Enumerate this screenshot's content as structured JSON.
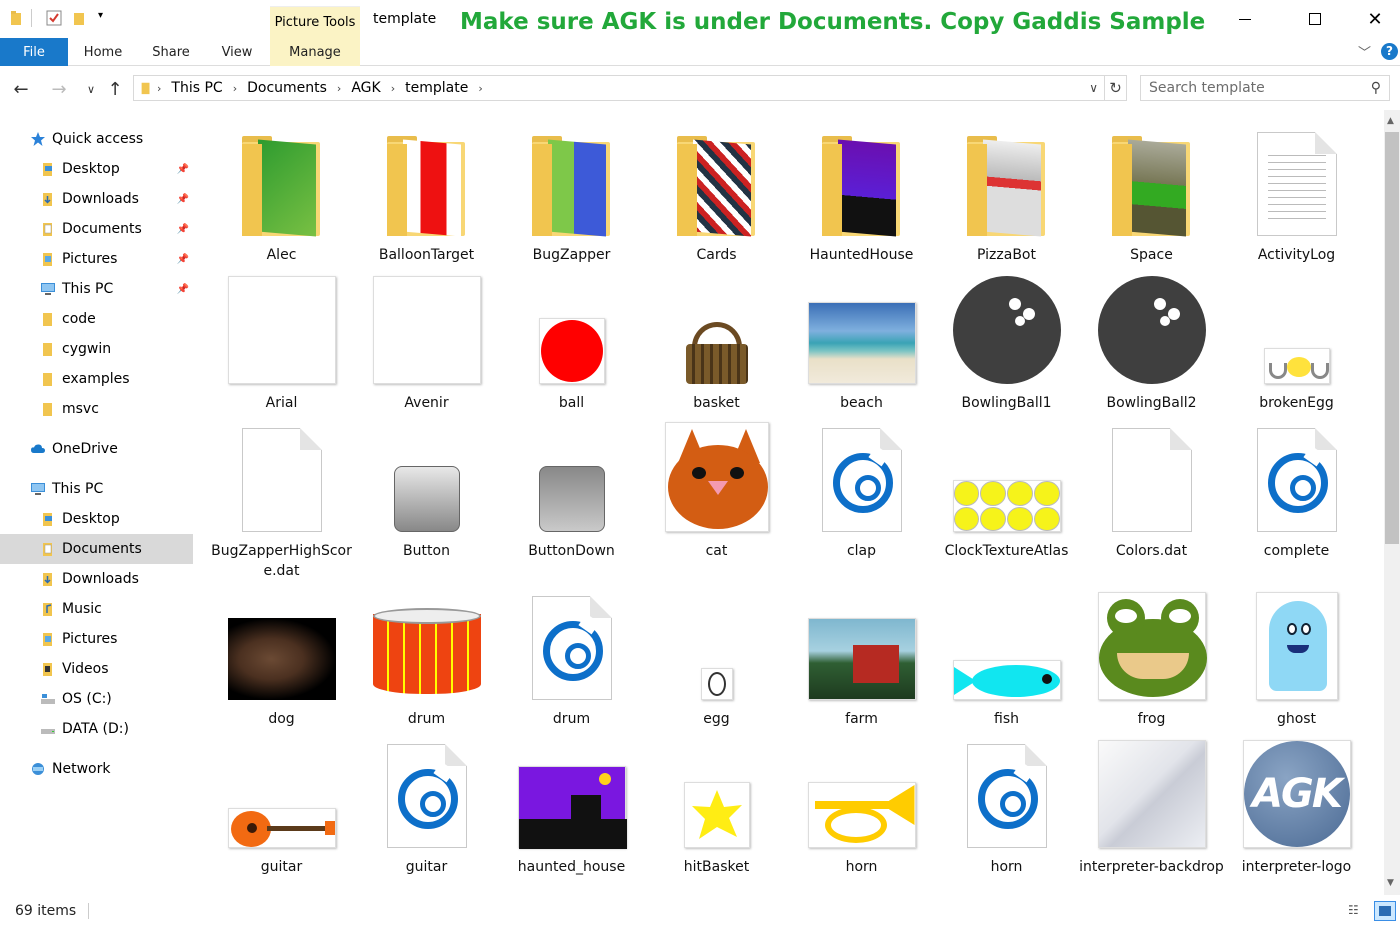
{
  "titlebar": {
    "contextual_group": "Picture Tools",
    "title": "template",
    "annotation": "Make sure AGK is under Documents. Copy Gaddis Sample Source Code media files into AGK/template"
  },
  "ribbon": {
    "tabs": [
      "File",
      "Home",
      "Share",
      "View",
      "Manage"
    ]
  },
  "address": {
    "crumbs": [
      "This PC",
      "Documents",
      "AGK",
      "template"
    ],
    "search_placeholder": "Search template"
  },
  "sidebar": {
    "items": [
      {
        "label": "Quick access",
        "icon": "star-icon",
        "level": 0,
        "pinned": false
      },
      {
        "label": "Desktop",
        "icon": "desktop-folder-icon",
        "level": 1,
        "pinned": true
      },
      {
        "label": "Downloads",
        "icon": "downloads-folder-icon",
        "level": 1,
        "pinned": true
      },
      {
        "label": "Documents",
        "icon": "documents-folder-icon",
        "level": 1,
        "pinned": true
      },
      {
        "label": "Pictures",
        "icon": "pictures-folder-icon",
        "level": 1,
        "pinned": true
      },
      {
        "label": "This PC",
        "icon": "computer-icon",
        "level": 1,
        "pinned": true
      },
      {
        "label": "code",
        "icon": "folder-icon",
        "level": 1,
        "pinned": false
      },
      {
        "label": "cygwin",
        "icon": "folder-icon",
        "level": 1,
        "pinned": false
      },
      {
        "label": "examples",
        "icon": "folder-icon",
        "level": 1,
        "pinned": false
      },
      {
        "label": "msvc",
        "icon": "folder-icon",
        "level": 1,
        "pinned": false
      },
      {
        "label": "OneDrive",
        "icon": "cloud-icon",
        "level": 0,
        "pinned": false
      },
      {
        "label": "This PC",
        "icon": "computer-icon",
        "level": 0,
        "pinned": false
      },
      {
        "label": "Desktop",
        "icon": "desktop-folder-icon",
        "level": 1,
        "pinned": false
      },
      {
        "label": "Documents",
        "icon": "documents-folder-icon",
        "level": 1,
        "pinned": false,
        "selected": true
      },
      {
        "label": "Downloads",
        "icon": "downloads-folder-icon",
        "level": 1,
        "pinned": false
      },
      {
        "label": "Music",
        "icon": "music-folder-icon",
        "level": 1,
        "pinned": false
      },
      {
        "label": "Pictures",
        "icon": "pictures-folder-icon",
        "level": 1,
        "pinned": false
      },
      {
        "label": "Videos",
        "icon": "videos-folder-icon",
        "level": 1,
        "pinned": false
      },
      {
        "label": "OS (C:)",
        "icon": "drive-c-icon",
        "level": 1,
        "pinned": false
      },
      {
        "label": "DATA (D:)",
        "icon": "drive-d-icon",
        "level": 1,
        "pinned": false
      },
      {
        "label": "Network",
        "icon": "network-icon",
        "level": 0,
        "pinned": false
      }
    ]
  },
  "files": [
    {
      "name": "Alec",
      "kind": "folder",
      "preview": "green"
    },
    {
      "name": "BalloonTarget",
      "kind": "folder",
      "preview": "red"
    },
    {
      "name": "BugZapper",
      "kind": "folder",
      "preview": "bluegreen"
    },
    {
      "name": "Cards",
      "kind": "folder",
      "preview": "cards"
    },
    {
      "name": "HauntedHouse",
      "kind": "folder",
      "preview": "purple"
    },
    {
      "name": "PizzaBot",
      "kind": "folder",
      "preview": "robot"
    },
    {
      "name": "Space",
      "kind": "folder",
      "preview": "space"
    },
    {
      "name": "ActivityLog",
      "kind": "text"
    },
    {
      "name": "Arial",
      "kind": "blank-image"
    },
    {
      "name": "Avenir",
      "kind": "blank-image"
    },
    {
      "name": "ball",
      "kind": "ball"
    },
    {
      "name": "basket",
      "kind": "basket"
    },
    {
      "name": "beach",
      "kind": "beach"
    },
    {
      "name": "BowlingBall1",
      "kind": "bowling"
    },
    {
      "name": "BowlingBall2",
      "kind": "bowling"
    },
    {
      "name": "brokenEgg",
      "kind": "brokenegg"
    },
    {
      "name": "BugZapperHighScore.dat",
      "kind": "doc"
    },
    {
      "name": "Button",
      "kind": "button"
    },
    {
      "name": "ButtonDown",
      "kind": "buttondown"
    },
    {
      "name": "cat",
      "kind": "cat"
    },
    {
      "name": "clap",
      "kind": "audio"
    },
    {
      "name": "ClockTextureAtlas",
      "kind": "clock"
    },
    {
      "name": "Colors.dat",
      "kind": "doc"
    },
    {
      "name": "complete",
      "kind": "audio"
    },
    {
      "name": "dog",
      "kind": "dog"
    },
    {
      "name": "drum",
      "kind": "drum"
    },
    {
      "name": "drum",
      "kind": "audio"
    },
    {
      "name": "egg",
      "kind": "egg"
    },
    {
      "name": "farm",
      "kind": "farm"
    },
    {
      "name": "fish",
      "kind": "fish"
    },
    {
      "name": "frog",
      "kind": "frog"
    },
    {
      "name": "ghost",
      "kind": "ghost"
    },
    {
      "name": "guitar",
      "kind": "guitar"
    },
    {
      "name": "guitar",
      "kind": "audio"
    },
    {
      "name": "haunted_house",
      "kind": "haunted"
    },
    {
      "name": "hitBasket",
      "kind": "hitbasket"
    },
    {
      "name": "horn",
      "kind": "horn"
    },
    {
      "name": "horn",
      "kind": "audio"
    },
    {
      "name": "interpreter-backdrop",
      "kind": "backdrop"
    },
    {
      "name": "interpreter-logo",
      "kind": "agklogo"
    }
  ],
  "status": {
    "item_count": "69 items"
  },
  "colors": {
    "accent": "#1979ca",
    "annotation": "#22a83a",
    "selected": "#d9d9d9",
    "contextual_tab": "#fbf3c5"
  }
}
